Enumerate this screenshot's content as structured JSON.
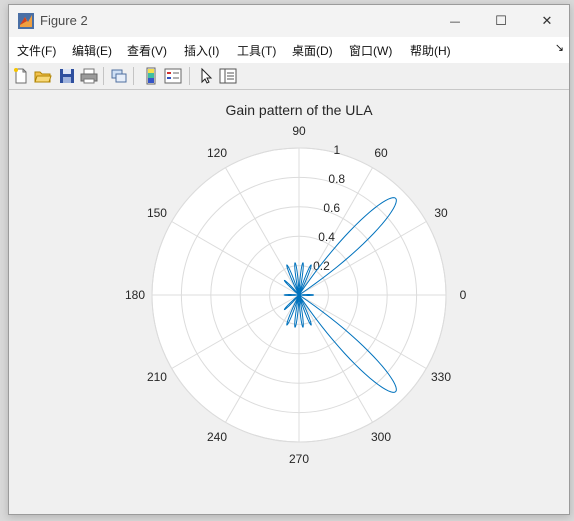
{
  "window": {
    "title": "Figure 2",
    "minimize_glyph": "—",
    "maximize_glyph": "☐",
    "close_glyph": "✕"
  },
  "menu": {
    "items": [
      "文件(F)",
      "编辑(E)",
      "查看(V)",
      "插入(I)",
      "工具(T)",
      "桌面(D)",
      "窗口(W)",
      "帮助(H)"
    ],
    "more_glyph": "↘"
  },
  "toolbar": {
    "icons": [
      "new-figure-icon",
      "open-file-icon",
      "save-icon",
      "print-icon",
      "link-icon",
      "colorbar-icon",
      "legend-icon",
      "pointer-icon",
      "property-inspector-icon"
    ]
  },
  "chart_data": {
    "type": "polar",
    "title": "Gain pattern of the ULA",
    "r_ticks": [
      "0.2",
      "0.4",
      "0.6",
      "0.8",
      "1"
    ],
    "theta_ticks": [
      "0",
      "30",
      "60",
      "90",
      "120",
      "150",
      "180",
      "210",
      "240",
      "270",
      "300",
      "330"
    ],
    "rlim": [
      0,
      1
    ],
    "grid": true,
    "series_color": "#0072bd",
    "series": [
      {
        "beam_directions_deg": [
          45,
          315
        ],
        "peak_gain": 0.93,
        "main_lobe_halfwidth_deg": 11,
        "side_lobes": [
          {
            "theta": 0,
            "gain": 0.1
          },
          {
            "theta": 68,
            "gain": 0.22
          },
          {
            "theta": 83,
            "gain": 0.22
          },
          {
            "theta": 97,
            "gain": 0.22
          },
          {
            "theta": 112,
            "gain": 0.22
          },
          {
            "theta": 135,
            "gain": 0.14
          },
          {
            "theta": 180,
            "gain": 0.1
          },
          {
            "theta": 225,
            "gain": 0.14
          },
          {
            "theta": 248,
            "gain": 0.22
          },
          {
            "theta": 263,
            "gain": 0.22
          },
          {
            "theta": 277,
            "gain": 0.22
          },
          {
            "theta": 292,
            "gain": 0.22
          }
        ],
        "side_lobe_halfwidth_deg": 5
      }
    ]
  }
}
